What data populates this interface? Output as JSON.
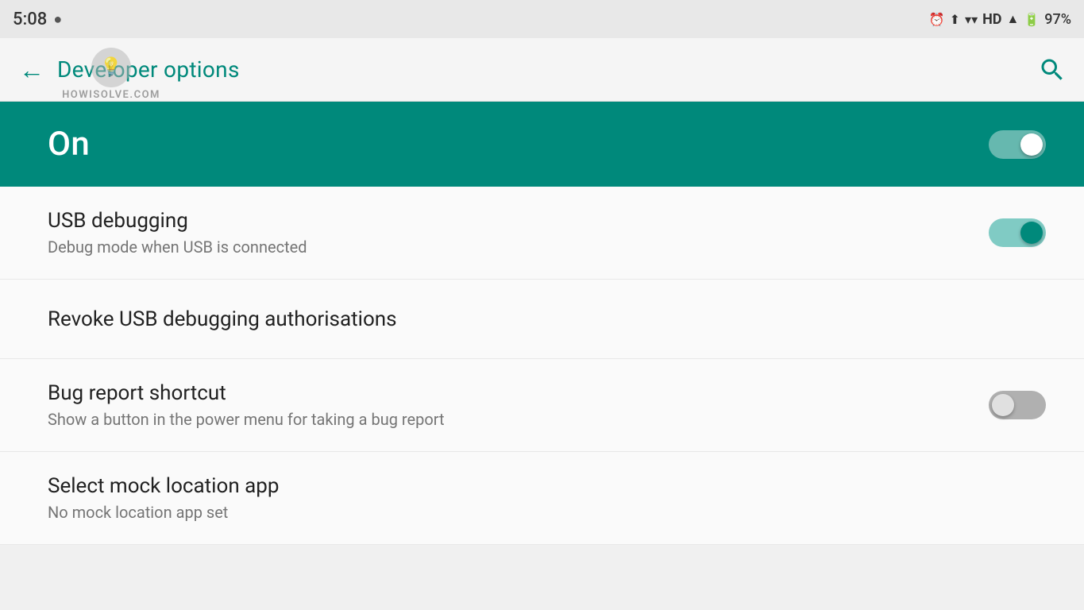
{
  "statusBar": {
    "time": "5:08",
    "battery": "97%",
    "icons": {
      "alarm": "⏰",
      "wifi": "▾",
      "hd": "HD",
      "signal": "▲",
      "battery": "🔋"
    }
  },
  "appBar": {
    "title": "Developer options",
    "backLabel": "←",
    "searchLabel": "🔍"
  },
  "watermark": "HOWISOLVE.COM",
  "devOptions": {
    "statusLabel": "On",
    "toggleState": "on"
  },
  "settings": [
    {
      "id": "usb-debugging",
      "title": "USB debugging",
      "subtitle": "Debug mode when USB is connected",
      "hasToggle": true,
      "toggleState": "enabled"
    },
    {
      "id": "revoke-usb",
      "title": "Revoke USB debugging authorisations",
      "subtitle": "",
      "hasToggle": false,
      "toggleState": null
    },
    {
      "id": "bug-report",
      "title": "Bug report shortcut",
      "subtitle": "Show a button in the power menu for taking a bug report",
      "hasToggle": true,
      "toggleState": "off"
    },
    {
      "id": "mock-location",
      "title": "Select mock location app",
      "subtitle": "No mock location app set",
      "hasToggle": false,
      "toggleState": null
    }
  ],
  "colors": {
    "teal": "#00897b",
    "tealLight": "#80cbc4",
    "white": "#ffffff",
    "textPrimary": "#212121",
    "textSecondary": "#757575"
  }
}
